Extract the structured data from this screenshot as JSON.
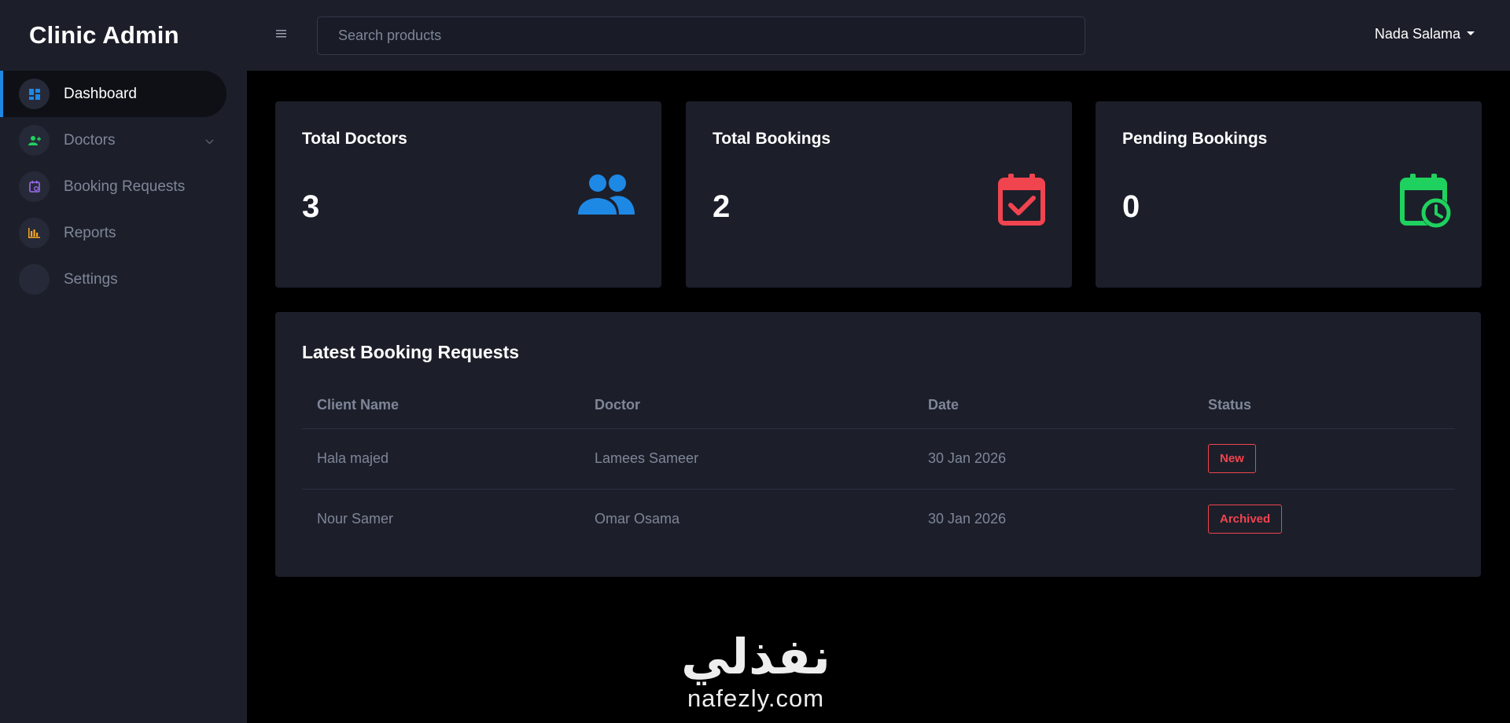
{
  "brand": {
    "title": "Clinic Admin"
  },
  "sidebar": {
    "items": [
      {
        "label": "Dashboard",
        "icon": "dashboard-icon",
        "active": true
      },
      {
        "label": "Doctors",
        "icon": "user-group-icon",
        "has_submenu": true
      },
      {
        "label": "Booking Requests",
        "icon": "calendar-icon"
      },
      {
        "label": "Reports",
        "icon": "bar-chart-icon"
      },
      {
        "label": "Settings",
        "icon": "settings-icon"
      }
    ]
  },
  "topbar": {
    "search_placeholder": "Search products",
    "user_name": "Nada Salama"
  },
  "stats": [
    {
      "title": "Total Doctors",
      "value": "3",
      "icon": "users-icon",
      "color": "#1e88e5"
    },
    {
      "title": "Total Bookings",
      "value": "2",
      "icon": "calendar-check-icon",
      "color": "#f0444f"
    },
    {
      "title": "Pending Bookings",
      "value": "0",
      "icon": "calendar-clock-icon",
      "color": "#1fd15e"
    }
  ],
  "latest_bookings": {
    "title": "Latest Booking Requests",
    "columns": [
      "Client Name",
      "Doctor",
      "Date",
      "Status"
    ],
    "rows": [
      {
        "client": "Hala majed",
        "doctor": "Lamees Sameer",
        "date": "30 Jan 2026",
        "status": "New"
      },
      {
        "client": "Nour Samer",
        "doctor": "Omar Osama",
        "date": "30 Jan 2026",
        "status": "Archived"
      }
    ]
  },
  "watermark": {
    "logo": "نفذلي",
    "url": "nafezly.com"
  },
  "colors": {
    "bg": "#000000",
    "panel": "#1c1f2a",
    "accent_blue": "#1e88e5",
    "accent_red": "#f0444f",
    "accent_green": "#1fd15e",
    "muted_text": "#7f8698"
  }
}
